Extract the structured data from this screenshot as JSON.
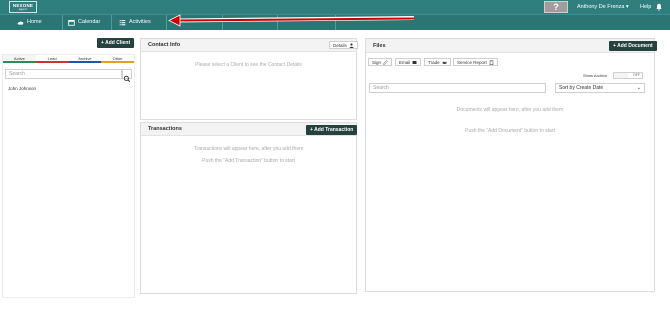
{
  "brand": {
    "logo_main": "NEXONE",
    "logo_sub": "agent"
  },
  "topbar": {
    "help_box": "?",
    "user_name": "Anthony De Frenza ▾",
    "help_label": "Help",
    "bell_icon": "bell-icon"
  },
  "nav": {
    "items": [
      {
        "label": "Home",
        "icon": "cloud-home-icon"
      },
      {
        "label": "Calendar",
        "icon": "calendar-icon"
      },
      {
        "label": "Activities",
        "icon": "list-icon"
      }
    ]
  },
  "annotation": {
    "color": "#cc0000"
  },
  "clients": {
    "add_button": "+ Add Client",
    "tabs": [
      {
        "label": "Active",
        "color": "#2e8b57"
      },
      {
        "label": "Lead",
        "color": "#cc3333"
      },
      {
        "label": "Archive",
        "color": "#2255aa"
      },
      {
        "label": "Other",
        "color": "#e0a020"
      }
    ],
    "search_placeholder": "Search",
    "list": [
      "John Johnson"
    ]
  },
  "contact": {
    "title": "Contact Info",
    "details_button": "Details",
    "empty_text": "Please select a Client to see the Contact Details"
  },
  "transactions": {
    "title": "Transactions",
    "add_button": "+ Add Transaction",
    "empty_line1": "Transactions will appear here, after you add them",
    "empty_line2": "Push the \"Add Transaction\" button to start"
  },
  "files": {
    "title": "Files",
    "add_button": "+ Add Document",
    "actions": [
      "Sign",
      "Email",
      "Trade",
      "Service Report"
    ],
    "show_archive_label": "Show Archive",
    "toggle_state": "OFF",
    "search_placeholder": "Search",
    "sort_value": "Sort by Create Date",
    "empty_line1": "Documents will appear here, after you add them",
    "empty_line2": "Push the \"Add Document\" button to start"
  },
  "colors": {
    "topbar": "#2f7f7e",
    "navbar": "#2b7574",
    "dark_button": "#25423f"
  }
}
